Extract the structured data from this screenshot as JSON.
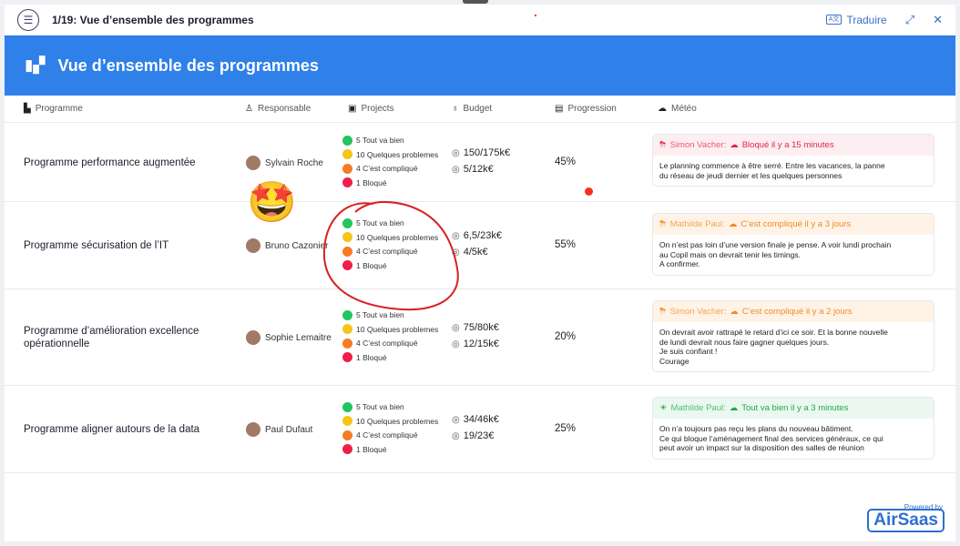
{
  "topbar": {
    "slide_title": "1/19: Vue d’ensemble des programmes",
    "translate_label": "Traduire",
    "translate_icon_text": "A文"
  },
  "hero": {
    "title": "Vue d’ensemble des programmes"
  },
  "columns": {
    "programme": "Programme",
    "responsable": "Responsable",
    "projects": "Projects",
    "budget": "Budget",
    "progression": "Progression",
    "meteo": "Météo"
  },
  "status_colors": {
    "good": "#22c55e",
    "problems": "#f5c518",
    "complicated": "#f57c22",
    "blocked": "#ef1f4a"
  },
  "rows": [
    {
      "programme": "Programme performance augmentée",
      "responsable": "Sylvain Roche",
      "projects": [
        "5 Tout va bien",
        "10 Quelques problemes",
        "4 C’est compliqué",
        "1 Bloqué"
      ],
      "budget": [
        "150/175k€",
        "5/12k€"
      ],
      "progression": "45%",
      "meteo": {
        "state": "blocked",
        "author": "Simon Vacher:",
        "status": "Bloqué il y a 15 minutes",
        "text": "Le planning commence à être serré. Entre les vacances, la panne\ndu réseau de jeudi dernier et les quelques personnes"
      }
    },
    {
      "programme": "Programme sécurisation de l’IT",
      "responsable": "Bruno Cazonier",
      "projects": [
        "5 Tout va bien",
        "10 Quelques problemes",
        "4 C’est compliqué",
        "1 Bloqué"
      ],
      "budget": [
        "6,5/23k€",
        "4/5k€"
      ],
      "progression": "55%",
      "meteo": {
        "state": "complicated",
        "author": "Mathilde Paul:",
        "status": "C’est compliqué il y a 3 jours",
        "text": "On n’est pas loin d’une version finale je pense. A voir lundi prochain\nau Copil mais on devrait tenir les timings.\nA confirmer."
      }
    },
    {
      "programme": "Programme d’amélioration excellence opérationnelle",
      "responsable": "Sophie Lemaitre",
      "projects": [
        "5 Tout va bien",
        "10 Quelques problemes",
        "4 C’est compliqué",
        "1 Bloqué"
      ],
      "budget": [
        "75/80k€",
        "12/15k€"
      ],
      "progression": "20%",
      "meteo": {
        "state": "complicated",
        "author": "Simon Vacher:",
        "status": "C’est compliqué il y a 2 jours",
        "text": "On devrait avoir rattrapé le retard d’ici ce soir. Et la bonne nouvelle\nde lundi devrait nous faire gagner quelques jours.\nJe suis confiant !\nCourage"
      }
    },
    {
      "programme": "Programme aligner autours de la data",
      "responsable": "Paul Dufaut",
      "projects": [
        "5 Tout va bien",
        "10 Quelques problemes",
        "4 C’est compliqué",
        "1 Bloqué"
      ],
      "budget": [
        "34/46k€",
        "19/23€"
      ],
      "progression": "25%",
      "meteo": {
        "state": "good",
        "author": "Mathilde Paul:",
        "status": "Tout va bien il y a 3 minutes",
        "text": "On n’a toujours pas reçu les plans du nouveau bâtiment.\nCe qui bloque l’aménagement final des services généraux, ce qui\npeut avoir un impact sur la disposition des salles de réunion"
      }
    }
  ],
  "footer": {
    "powered_by": "Powered by",
    "brand": "AirSaas"
  }
}
